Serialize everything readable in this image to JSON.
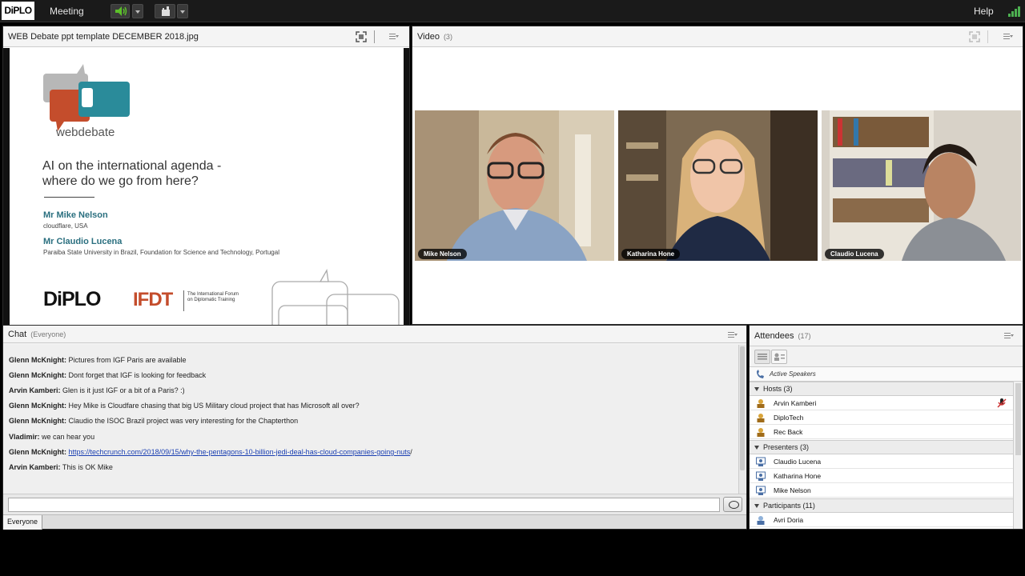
{
  "topbar": {
    "logo": "DiPLO",
    "menu": [
      "Meeting"
    ],
    "help": "Help"
  },
  "share": {
    "title": "WEB Debate ppt template DECEMBER 2018.jpg",
    "slide": {
      "brand": "webdebate",
      "heading_line1": "AI on the international agenda -",
      "heading_line2": "where do we go from here?",
      "speakers": [
        {
          "name": "Mr Mike Nelson",
          "affiliation": "cloudflare, USA"
        },
        {
          "name": "Mr Claudio Lucena",
          "affiliation": "Paraiba State University in Brazil, Foundation for Science and Technology, Portugal"
        }
      ],
      "logo_diplo": "DiPLO",
      "logo_ifdt": "IFDT",
      "ifdt_subtitle": "The International Forum on Diplomatic Training"
    }
  },
  "video": {
    "title": "Video",
    "count": "(3)",
    "feeds": [
      {
        "name": "Mike Nelson"
      },
      {
        "name": "Katharina Hone"
      },
      {
        "name": "Claudio Lucena"
      }
    ]
  },
  "chat": {
    "title": "Chat",
    "scope": "(Everyone)",
    "messages": [
      {
        "sender": "Glenn McKnight:",
        "text": "Pictures from IGF  Paris are available"
      },
      {
        "sender": "Glenn McKnight:",
        "text": "Dont  forget that  IGF is looking for feedback"
      },
      {
        "sender": "Arvin Kamberi:",
        "text": "Glen is it just IGF or a bit of a Paris? :)"
      },
      {
        "sender": "Glenn McKnight:",
        "text": "Hey Mike is    Cloudfare chasing that big  US  Military cloud project that  has  Microsoft all over?"
      },
      {
        "sender": "Glenn McKnight:",
        "text": "Claudio  the ISOC Brazil project was very interesting for the Chapterthon"
      },
      {
        "sender": "Vladimir:",
        "text": "we can hear you"
      },
      {
        "sender": "Glenn McKnight:",
        "text": "https://techcrunch.com/2018/09/15/why-the-pentagons-10-billion-jedi-deal-has-cloud-companies-going-nuts",
        "suffix": "/"
      },
      {
        "sender": "Arvin Kamberi:",
        "text": "This is OK Mike"
      }
    ],
    "input_value": "",
    "tab": "Everyone"
  },
  "attendees": {
    "title": "Attendees",
    "count": "(17)",
    "active_speakers": "Active Speakers",
    "groups": [
      {
        "label": "Hosts (3)",
        "members": [
          "Arvin Kamberi",
          "DiploTech",
          "Rec Back"
        ]
      },
      {
        "label": "Presenters (3)",
        "members": [
          "Claudio Lucena",
          "Katharina Hone",
          "Mike Nelson"
        ]
      },
      {
        "label": "Participants (11)",
        "members": [
          "Avri Doria"
        ]
      }
    ]
  },
  "colors": {
    "accent_teal": "#2a6f7f",
    "accent_orange": "#c44d2c",
    "signal_green": "#4caf50",
    "link_blue": "#1a3fb2"
  }
}
